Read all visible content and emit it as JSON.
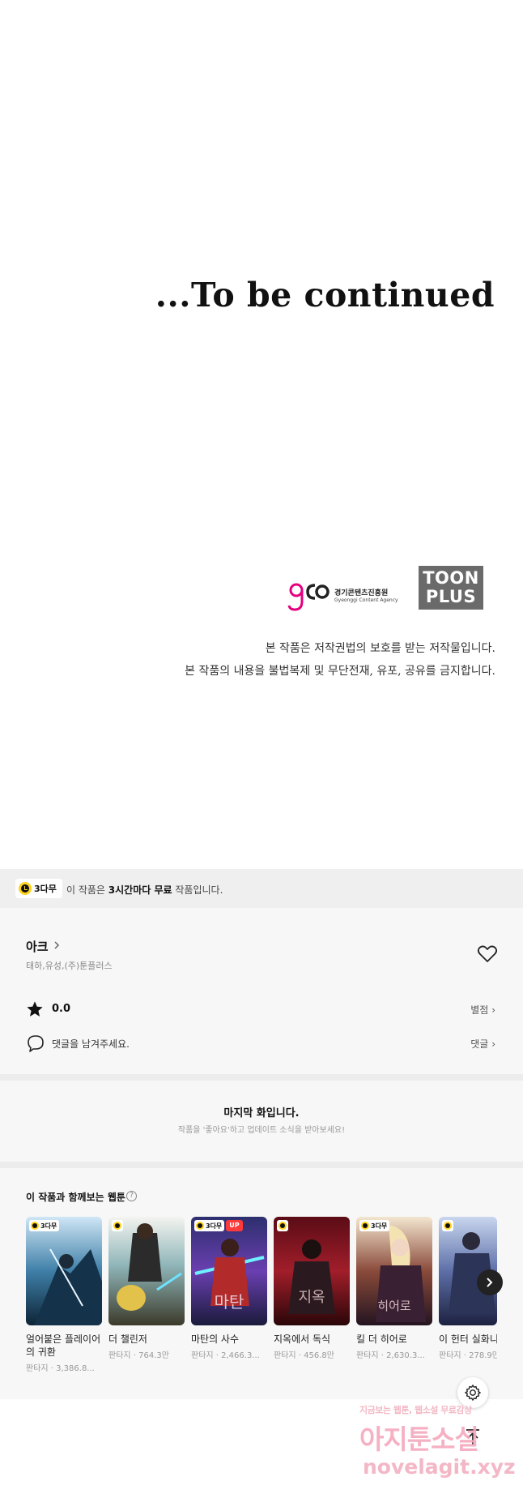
{
  "end_panel": {
    "to_be_continued": "...To be continued",
    "gca_korean": "경기콘텐츠진흥원",
    "gca_english": "Gyeonggi Content Agency",
    "toonplus_line1": "TOON",
    "toonplus_line2": "PLUS",
    "notice_line1": "본 작품은 저작권법의 보호를 받는 저작물입니다.",
    "notice_line2": "본 작품의 내용을 불법복제 및 무단전재, 유포, 공유를 금지합니다."
  },
  "free_banner": {
    "badge": "3다무",
    "text_prefix": "이 작품은 ",
    "text_bold": "3시간마다 무료",
    "text_suffix": " 작품입니다."
  },
  "work": {
    "title": "아크",
    "authors": "태하,유성,(주)툰플러스",
    "rating": "0.0",
    "rate_link": "별점",
    "comment_prompt": "댓글을 남겨주세요.",
    "comment_link": "댓글"
  },
  "last_episode": {
    "title": "마지막 화입니다.",
    "subtitle": "작품을 '좋아요'하고 업데이트 소식을 받아보세요!"
  },
  "recommendations": {
    "heading": "이 작품과 함께보는 웹툰",
    "help": "?",
    "items": [
      {
        "name": "얼어붙은 플레이어의 귀환",
        "meta": "판타지 · 3,386.8...",
        "badge": "3다무",
        "up": false
      },
      {
        "name": "더 챌린저",
        "meta": "판타지 · 764.3만",
        "badge": "clock",
        "up": false
      },
      {
        "name": "마탄의 사수",
        "meta": "판타지 · 2,466.3...",
        "badge": "3다무",
        "up": true,
        "up_label": "UP"
      },
      {
        "name": "지옥에서 독식",
        "meta": "판타지 · 456.8만",
        "badge": "clock",
        "up": false
      },
      {
        "name": "킬 더 히어로",
        "meta": "판타지 · 2,630.3...",
        "badge": "3다무",
        "up": false
      },
      {
        "name": "이 헌터 실화니",
        "meta": "판타지 · 278.9만",
        "badge": "clock",
        "up": false
      }
    ]
  },
  "watermark": {
    "line1": "지금보는 웹툰, 웹소설 무료감상",
    "line2": "아지툰소설",
    "line3": "novelagit.xyz"
  },
  "icons": {
    "heart": "heart-icon",
    "star": "star-icon",
    "comment": "comment-icon",
    "gear": "gear-icon",
    "top": "arrow-up-icon",
    "next": "chevron-right-icon"
  },
  "colors": {
    "accent_yellow": "#ffd21e",
    "up_red": "#ff3a3a",
    "toonplus_gray": "#6a6a6a",
    "gca_pink": "#e4007f"
  }
}
